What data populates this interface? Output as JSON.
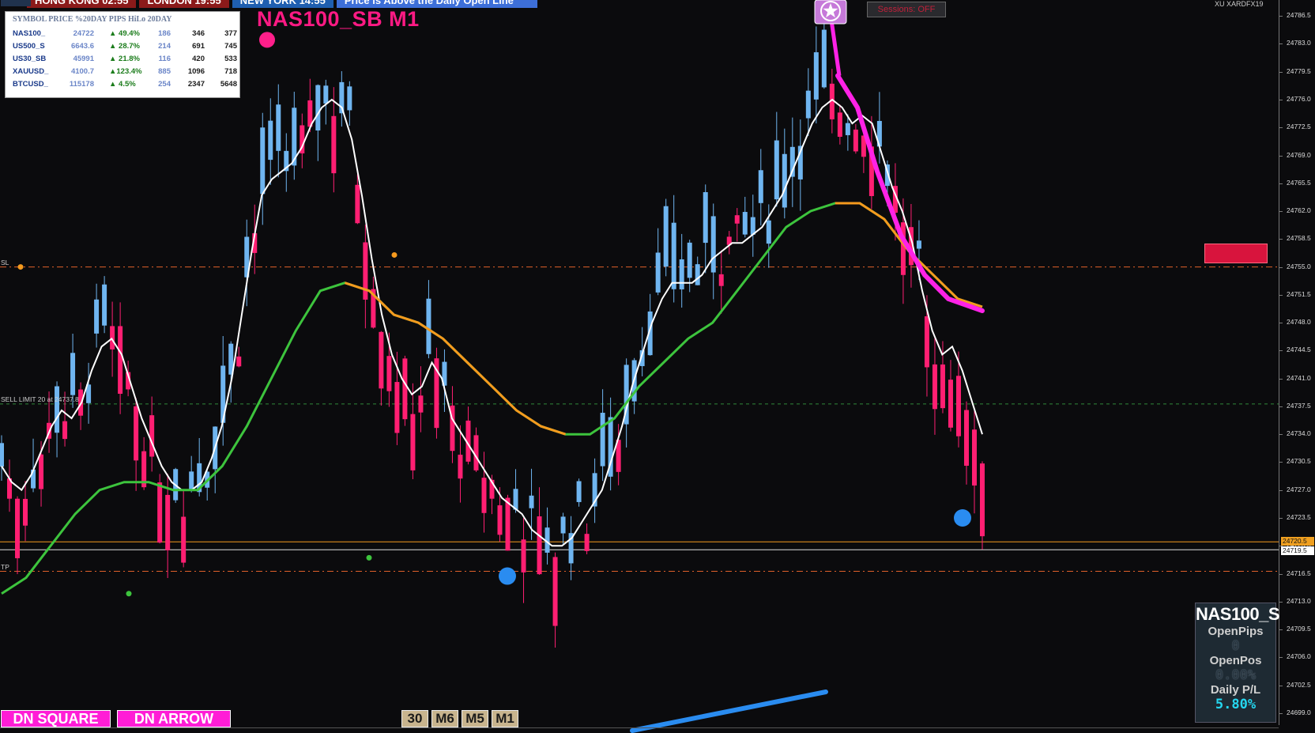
{
  "header": {
    "sessions": [
      {
        "label": "HONG KONG  02:55",
        "color": "#8b1a1a"
      },
      {
        "label": "LONDON  19:55",
        "color": "#8b1a1a"
      },
      {
        "label": "NEW YORK  14:55",
        "color": "#1f5fb0"
      },
      {
        "label": "Price is Above the Daily Open Line",
        "color": "#3d6fd8"
      }
    ],
    "symbol_title": "NAS100_SB M1",
    "sessions_button": "Sessions: OFF",
    "broker_label": "XU XARDFX19"
  },
  "market_table": {
    "header": "SYMBOL PRICE %20DAY PIPS HiLo 20DAY",
    "rows": [
      {
        "symbol": "NAS100_",
        "price": "24722",
        "pct": "▲ 49.4%",
        "pips": "186",
        "hi": "346",
        "lo": "377"
      },
      {
        "symbol": "US500_S",
        "price": "6643.6",
        "pct": "▲ 28.7%",
        "pips": "214",
        "hi": "691",
        "lo": "745"
      },
      {
        "symbol": "US30_SB",
        "price": "45991",
        "pct": "▲ 21.8%",
        "pips": "116",
        "hi": "420",
        "lo": "533"
      },
      {
        "symbol": "XAUUSD_",
        "price": "4100.7",
        "pct": "▲123.4%",
        "pips": "885",
        "hi": "1096",
        "lo": "718"
      },
      {
        "symbol": "BTCUSD_",
        "price": "115178",
        "pct": "▲ 4.5%",
        "pips": "254",
        "hi": "2347",
        "lo": "5648"
      }
    ]
  },
  "price_axis": {
    "ticks": [
      "24786.5",
      "24783.0",
      "24779.5",
      "24776.0",
      "24772.5",
      "24769.0",
      "24765.5",
      "24762.0",
      "24758.5",
      "24755.0",
      "24751.5",
      "24748.0",
      "24744.5",
      "24741.0",
      "24737.5",
      "24734.0",
      "24730.5",
      "24727.0",
      "24723.5",
      "24720.0",
      "24716.5",
      "24713.0",
      "24709.5",
      "24706.0",
      "24702.5",
      "24699.0"
    ],
    "ask_tag": "24720.5",
    "bid_tag": "24719.5",
    "ask_color": "#f0a020",
    "bid_color": "#ffffff"
  },
  "levels": {
    "sl_label": "SL",
    "sl_price": 24755.0,
    "sell_limit_label": "SELL LIMIT 20 at 24737.8",
    "sell_limit_price": 24737.8,
    "tp_label": "TP",
    "tp_price": 24716.8,
    "ask_price": 24720.5,
    "bid_price": 24719.5
  },
  "pl_panel": {
    "symbol": "NAS100_S",
    "open_pips_label": "OpenPips",
    "open_pips_value": "0",
    "open_pos_label": "OpenPos",
    "open_pos_value": "0.00%",
    "daily_pl_label": "Daily P/L",
    "daily_pl_value": "5.80%"
  },
  "buttons": {
    "dn_square": "DN SQUARE",
    "dn_arrow": "DN ARROW"
  },
  "timeframes": [
    "30",
    "M6",
    "M5",
    "M1"
  ],
  "colors": {
    "bull": "#6fb5f0",
    "bear": "#ff1f72",
    "neutral": "#444446",
    "fast_ma": "#ffffff",
    "mid_ma_up": "#3dc43d",
    "mid_ma_dn": "#f59a1e",
    "trend": "#ff22e6",
    "sl_tp_line": "#e0602a",
    "sell_limit_line": "#2f8a3a",
    "blue_dot": "#2a8cf0",
    "pink_dot": "#ff1f8a"
  },
  "chart_data": {
    "type": "line",
    "symbol": "NAS100_SB",
    "timeframe": "M1",
    "ylim": [
      24697.5,
      24788.5
    ],
    "fast_ma": [
      24730,
      24728,
      24727,
      24729,
      24732,
      24735,
      24737,
      24736,
      24738,
      24742,
      24745,
      24746,
      24744,
      24740,
      24736,
      24733,
      24730,
      24728,
      24727,
      24727,
      24728,
      24731,
      24735,
      24741,
      24749,
      24757,
      24764,
      24766,
      24767,
      24768,
      24770,
      24773,
      24775,
      24776,
      24775,
      24771,
      24764,
      24756,
      24749,
      24744,
      24741,
      24739,
      24740,
      24743,
      24741,
      24736,
      24734,
      24732,
      24730,
      24728,
      24726,
      24725,
      24724,
      24722,
      24721,
      24720,
      24720,
      24721,
      24723,
      24725,
      24727,
      24731,
      24735,
      24740,
      24744,
      24748,
      24751,
      24753,
      24753,
      24753,
      24754,
      24756,
      24757,
      24758,
      24758,
      24759,
      24760,
      24762,
      24764,
      24767,
      24770,
      24773,
      24775,
      24776,
      24775,
      24773,
      24774,
      24773,
      24769,
      24765,
      24762,
      24758,
      24752,
      24747,
      24744,
      24745,
      24742,
      24738,
      24734
    ]
  }
}
